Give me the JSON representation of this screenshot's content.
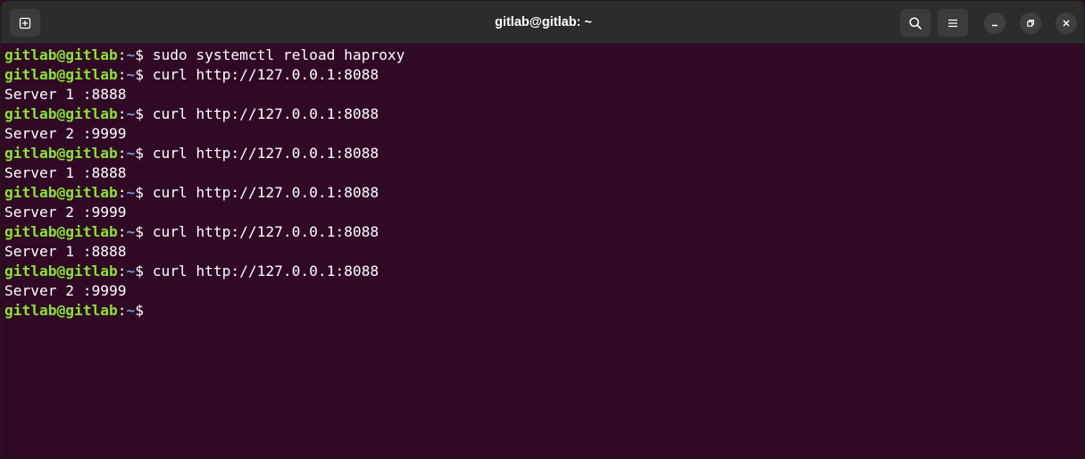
{
  "window": {
    "title": "gitlab@gitlab: ~"
  },
  "icons": {
    "new_tab": "new-tab-icon",
    "search": "search-icon",
    "menu": "hamburger-menu-icon",
    "minimize": "minimize-icon",
    "maximize": "restore-icon",
    "close": "close-icon"
  },
  "colors": {
    "background": "#300a24",
    "prompt_user": "#8ae234",
    "prompt_path": "#729fcf",
    "text": "#ffffff",
    "titlebar": "#2c2c2c"
  },
  "prompt": {
    "user_host": "gitlab@gitlab",
    "colon": ":",
    "path": "~",
    "symbol": "$"
  },
  "lines": [
    {
      "type": "prompt",
      "command": " sudo systemctl reload haproxy"
    },
    {
      "type": "prompt",
      "command": " curl http://127.0.0.1:8088"
    },
    {
      "type": "output",
      "text": "Server 1 :8888"
    },
    {
      "type": "prompt",
      "command": " curl http://127.0.0.1:8088"
    },
    {
      "type": "output",
      "text": "Server 2 :9999"
    },
    {
      "type": "prompt",
      "command": " curl http://127.0.0.1:8088"
    },
    {
      "type": "output",
      "text": "Server 1 :8888"
    },
    {
      "type": "prompt",
      "command": " curl http://127.0.0.1:8088"
    },
    {
      "type": "output",
      "text": "Server 2 :9999"
    },
    {
      "type": "prompt",
      "command": " curl http://127.0.0.1:8088"
    },
    {
      "type": "output",
      "text": "Server 1 :8888"
    },
    {
      "type": "prompt",
      "command": " curl http://127.0.0.1:8088"
    },
    {
      "type": "output",
      "text": "Server 2 :9999"
    },
    {
      "type": "prompt",
      "command": ""
    }
  ]
}
